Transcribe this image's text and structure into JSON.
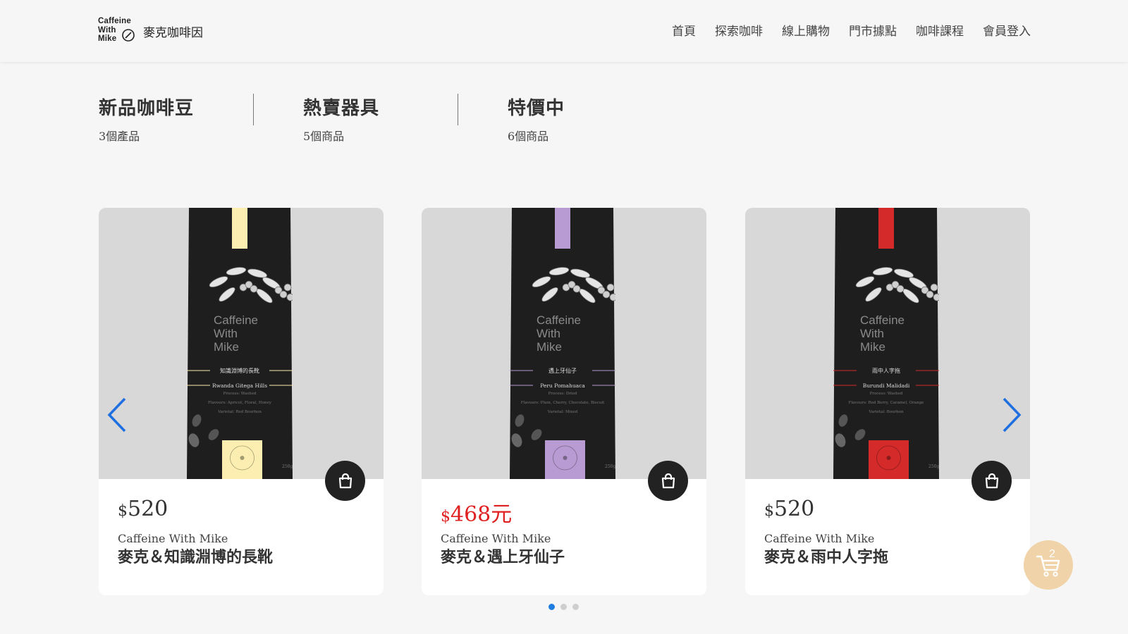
{
  "header": {
    "logo_lines": [
      "Caffeine",
      "With",
      "Mike"
    ],
    "brand_name": "麥克咖啡因",
    "nav": [
      "首頁",
      "探索咖啡",
      "線上購物",
      "門市據點",
      "咖啡課程",
      "會員登入"
    ]
  },
  "categories": [
    {
      "title": "新品咖啡豆",
      "count": "3個產品"
    },
    {
      "title": "熱賣器具",
      "count": "5個商品"
    },
    {
      "title": "特價中",
      "count": "6個商品"
    }
  ],
  "products": [
    {
      "currency": "$",
      "price": "520",
      "sale": false,
      "brand": "Caffeine With Mike",
      "name": "麥克＆知識淵博的長靴",
      "label_cn": "知識淵博的長靴",
      "label_en": "Rwanda Gitega Hills",
      "label_lines": [
        "Process: Washed",
        "Flavours: Apricot, Floral, Honey",
        "Varietal: Red Bourbon"
      ],
      "bag_brand": [
        "Caffeine",
        "With",
        "Mike"
      ],
      "weight": "250g",
      "accent": "#fbeeb0"
    },
    {
      "currency": "$",
      "price": "468元",
      "sale": true,
      "brand": "Caffeine With Mike",
      "name": "麥克＆遇上牙仙子",
      "label_cn": "遇上牙仙子",
      "label_en": "Peru Pomahuaca",
      "label_lines": [
        "Process: Dried",
        "Flavours: Plum, Cherry, Chocolate, Biscuit",
        "Varietal: Mixed"
      ],
      "bag_brand": [
        "Caffeine",
        "With",
        "Mike"
      ],
      "weight": "250g",
      "accent": "#b79bd2"
    },
    {
      "currency": "$",
      "price": "520",
      "sale": false,
      "brand": "Caffeine With Mike",
      "name": "麥克＆雨中人字拖",
      "label_cn": "雨中人字拖",
      "label_en": "Burundi Malidadi",
      "label_lines": [
        "Process: Washed",
        "Flavours: Red Berry, Caramel, Orange",
        "Varietal: Bourbon"
      ],
      "bag_brand": [
        "Caffeine",
        "With",
        "Mike"
      ],
      "weight": "250g",
      "accent": "#d42a2a"
    }
  ],
  "carousel": {
    "pages": 3,
    "active_page": 1
  },
  "cart": {
    "count": "2"
  },
  "colors": {
    "background": "#f6f6f6",
    "sale": "#e02020",
    "dot_active": "#1f7de0",
    "cart_button": "#222222",
    "floating_cart": "#f0d3a8"
  }
}
